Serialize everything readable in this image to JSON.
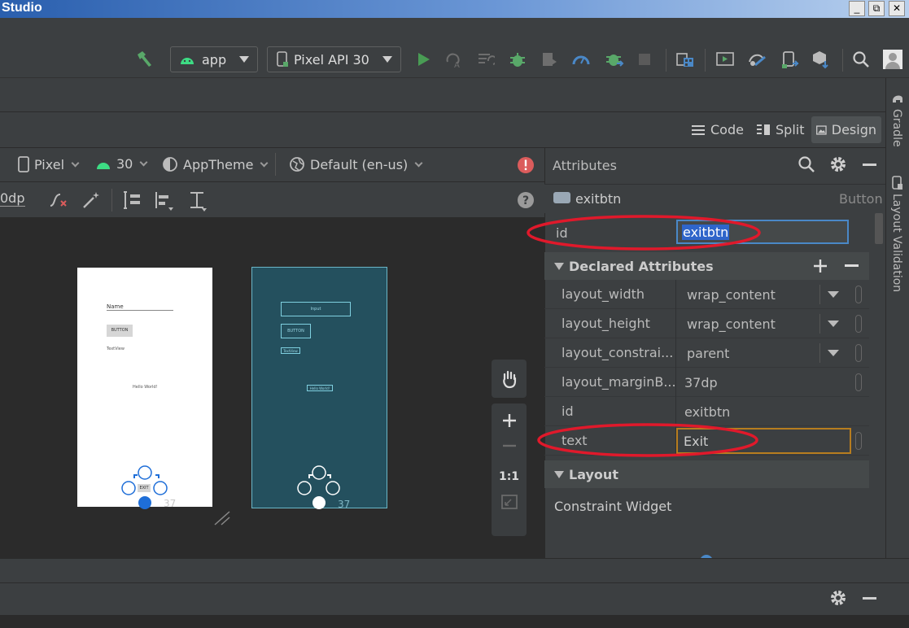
{
  "window": {
    "title": "Studio",
    "buttons": [
      "_",
      "⧉",
      "✕"
    ]
  },
  "toolbar": {
    "module_label": "app",
    "device_label": "Pixel API 30",
    "icons": [
      "hammer-icon",
      "android-icon",
      "run-icon",
      "apply-changes-icon",
      "apply-code-icon",
      "debug-icon",
      "profile-icon",
      "coverage-icon",
      "attach-debugger-icon",
      "stop-icon",
      "project-structure-icon",
      "avd-manager-icon",
      "sync-icon",
      "device-manager-icon",
      "sdk-manager-icon",
      "search-icon",
      "user-icon"
    ]
  },
  "view_tabs": {
    "code": "Code",
    "split": "Split",
    "design": "Design"
  },
  "design_toolbar": {
    "device": "Pixel",
    "api": "30",
    "theme": "AppTheme",
    "locale": "Default (en-us)",
    "margin_value": "0dp"
  },
  "preview": {
    "name_hint": "Name",
    "button_label": "BUTTON",
    "textview_label": "TextView",
    "hello": "Hello World!",
    "exit": "EXIT",
    "margin_badge": "37",
    "blueprint_input": "Input",
    "blueprint_button": "BUTTON",
    "blueprint_textview": "TextView",
    "blueprint_hello": "Hello World!"
  },
  "zoom": {
    "one_to_one": "1:1"
  },
  "attributes": {
    "title": "Attributes",
    "component_id": "exitbtn",
    "component_type": "Button",
    "id_label": "id",
    "id_value": "exitbtn",
    "declared_title": "Declared Attributes",
    "rows": [
      {
        "name": "layout_width",
        "value": "wrap_content"
      },
      {
        "name": "layout_height",
        "value": "wrap_content"
      },
      {
        "name": "layout_constrai...",
        "value": "parent"
      },
      {
        "name": "layout_marginB...",
        "value": "37dp"
      },
      {
        "name": "id",
        "value": "exitbtn"
      },
      {
        "name": "text",
        "value": "Exit"
      }
    ],
    "layout_title": "Layout",
    "layout_widget": "Constraint Widget"
  },
  "sidebar": {
    "gradle": "Gradle",
    "layout_validation": "Layout Validation"
  },
  "colors": {
    "accent": "#4a88c7",
    "annotation_red": "#e0192b",
    "focus_orange": "#b77d1f",
    "blueprint": "#24505e"
  }
}
